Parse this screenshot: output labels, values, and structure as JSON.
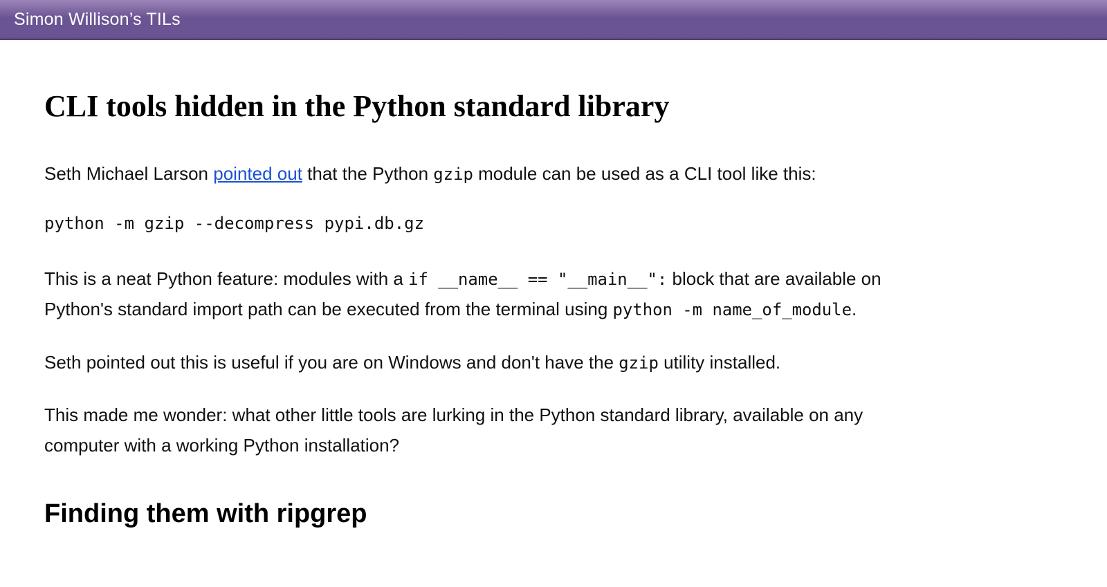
{
  "header": {
    "site_title": "Simon Willison’s TILs"
  },
  "article": {
    "title": "CLI tools hidden in the Python standard library",
    "p1": {
      "t1": "Seth Michael Larson ",
      "link": "pointed out",
      "t2": " that the Python ",
      "code1": "gzip",
      "t3": " module can be used as a CLI tool like this:"
    },
    "code_block_1": "python -m gzip --decompress pypi.db.gz",
    "p2": {
      "t1": "This is a neat Python feature: modules with a ",
      "code1": "if __name__ == \"__main__\":",
      "t2": " block that are available on Python's standard import path can be executed from the terminal using ",
      "code2": "python -m name_of_module",
      "t3": "."
    },
    "p3": {
      "t1": "Seth pointed out this is useful if you are on Windows and don't have the ",
      "code1": "gzip",
      "t2": " utility installed."
    },
    "p4": "This made me wonder: what other little tools are lurking in the Python standard library, available on any computer with a working Python installation?",
    "h2_1": "Finding them with ripgrep"
  }
}
